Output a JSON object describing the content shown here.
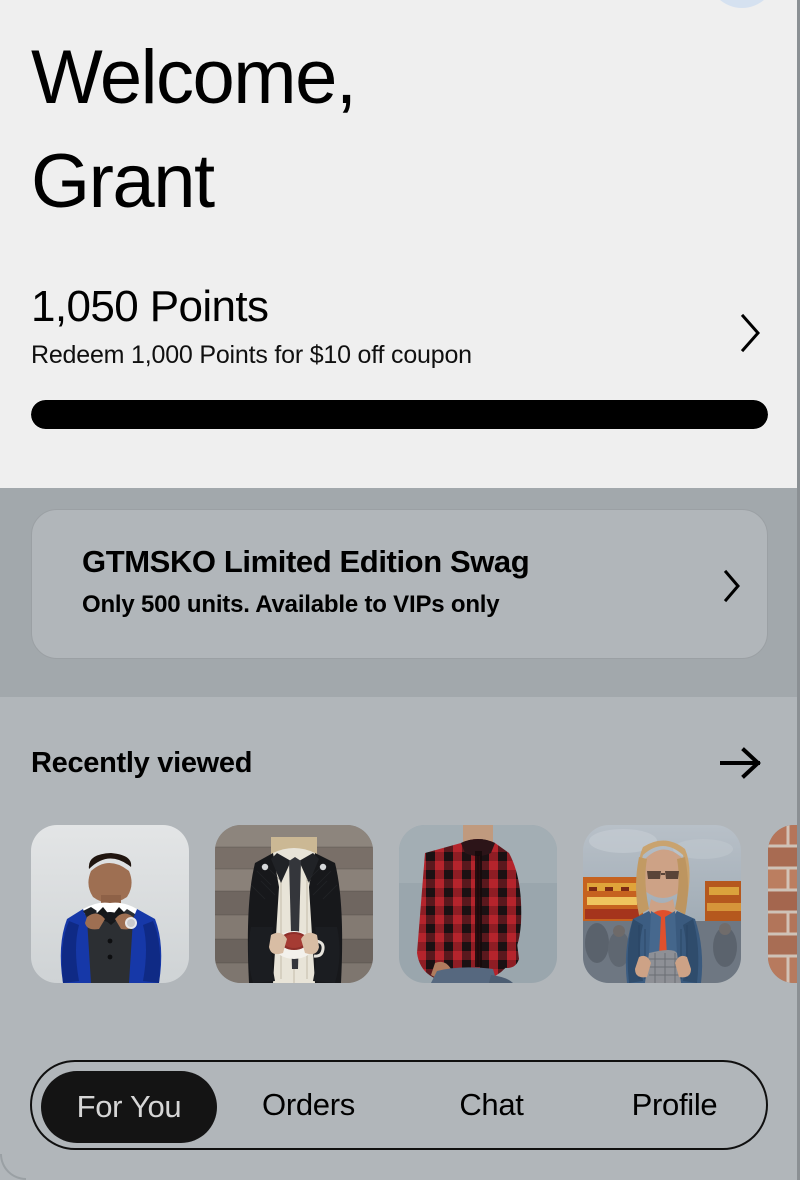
{
  "hero": {
    "greeting_line1": "Welcome,",
    "greeting_line2": "Grant",
    "points_value": "1,050 Points",
    "points_subtitle": "Redeem 1,000 Points for $10 off coupon",
    "points_chevron_icon": "chevron-right-icon",
    "progress_percent": 100,
    "background_color": "#efefef",
    "status_blob_color": "#d5e1f0"
  },
  "promo": {
    "title": "GTMSKO Limited Edition Swag",
    "subtitle": "Only 500 units. Available to VIPs only",
    "chevron_icon": "chevron-right-icon",
    "band_color": "#a2a8ac",
    "card_color": "#b1b6ba"
  },
  "recently_viewed": {
    "title": "Recently viewed",
    "arrow_icon": "arrow-right-icon",
    "items": [
      {
        "alt": "Man in blue patterned tuxedo jacket adjusting bow tie"
      },
      {
        "alt": "Person in black quilted leather jacket holding white mug of tea"
      },
      {
        "alt": "Red and black buffalo plaid flannel shirt on blue-gray backdrop"
      },
      {
        "alt": "Woman in denim jacket and orange crop top at a carnival"
      },
      {
        "alt": "Red brick wall with dark bag"
      }
    ]
  },
  "bottom_nav": {
    "items": [
      {
        "label": "For You",
        "active": true
      },
      {
        "label": "Orders",
        "active": false
      },
      {
        "label": "Chat",
        "active": false
      },
      {
        "label": "Profile",
        "active": false
      }
    ],
    "active_pill_color": "#141414",
    "active_text_color": "#d6d6d6",
    "border_color": "#101010"
  }
}
